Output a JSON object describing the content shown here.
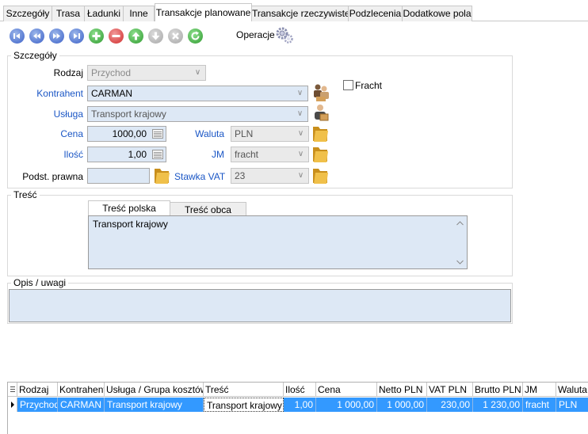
{
  "tabs": [
    {
      "label": "Szczegóły",
      "active": false
    },
    {
      "label": "Trasa",
      "active": false
    },
    {
      "label": "Ładunki",
      "active": false
    },
    {
      "label": "Inne",
      "active": false
    },
    {
      "label": "Transakcje planowane",
      "active": true
    },
    {
      "label": "Transakcje rzeczywiste",
      "active": false
    },
    {
      "label": "Podzlecenia",
      "active": false
    },
    {
      "label": "Dodatkowe pola",
      "active": false
    }
  ],
  "toolbar": {
    "buttons": [
      "first-icon",
      "prev-icon",
      "next-icon",
      "last-icon",
      "add-icon",
      "delete-icon",
      "move-up-icon",
      "move-down-icon",
      "cancel-icon",
      "refresh-icon"
    ],
    "operations_label": "Operacje"
  },
  "details": {
    "title": "Szczegóły",
    "rodzaj": {
      "label": "Rodzaj",
      "value": "Przychod"
    },
    "kontrahent": {
      "label": "Kontrahent",
      "value": "CARMAN"
    },
    "usluga": {
      "label": "Usługa",
      "value": "Transport krajowy"
    },
    "cena": {
      "label": "Cena",
      "value": "1000,00"
    },
    "waluta": {
      "label": "Waluta",
      "value": "PLN"
    },
    "ilosc": {
      "label": "Ilość",
      "value": "1,00"
    },
    "jm": {
      "label": "JM",
      "value": "fracht"
    },
    "podst": {
      "label": "Podst. prawna",
      "value": ""
    },
    "vat": {
      "label": "Stawka VAT",
      "value": "23"
    },
    "fracht": {
      "label": "Fracht",
      "checked": false
    }
  },
  "content": {
    "title": "Treść",
    "tab_pl": "Treść polska",
    "tab_foreign": "Treść obca",
    "text": "Transport krajowy"
  },
  "notes": {
    "title": "Opis / uwagi",
    "text": ""
  },
  "grid": {
    "columns": [
      "Rodzaj",
      "Kontrahent",
      "Usługa / Grupa kosztów",
      "Treść",
      "Ilość",
      "Cena",
      "Netto PLN",
      "VAT PLN",
      "Brutto PLN",
      "JM",
      "Waluta"
    ],
    "rows": [
      [
        "Przychod",
        "CARMAN",
        "Transport krajowy",
        "Transport krajowy",
        "1,00",
        "1 000,00",
        "1 000,00",
        "230,00",
        "1 230,00",
        "fracht",
        "PLN"
      ]
    ]
  },
  "colors": {
    "selection": "#3399ff",
    "field_bg": "#dde8f5",
    "label_blue": "#1a56c5"
  }
}
